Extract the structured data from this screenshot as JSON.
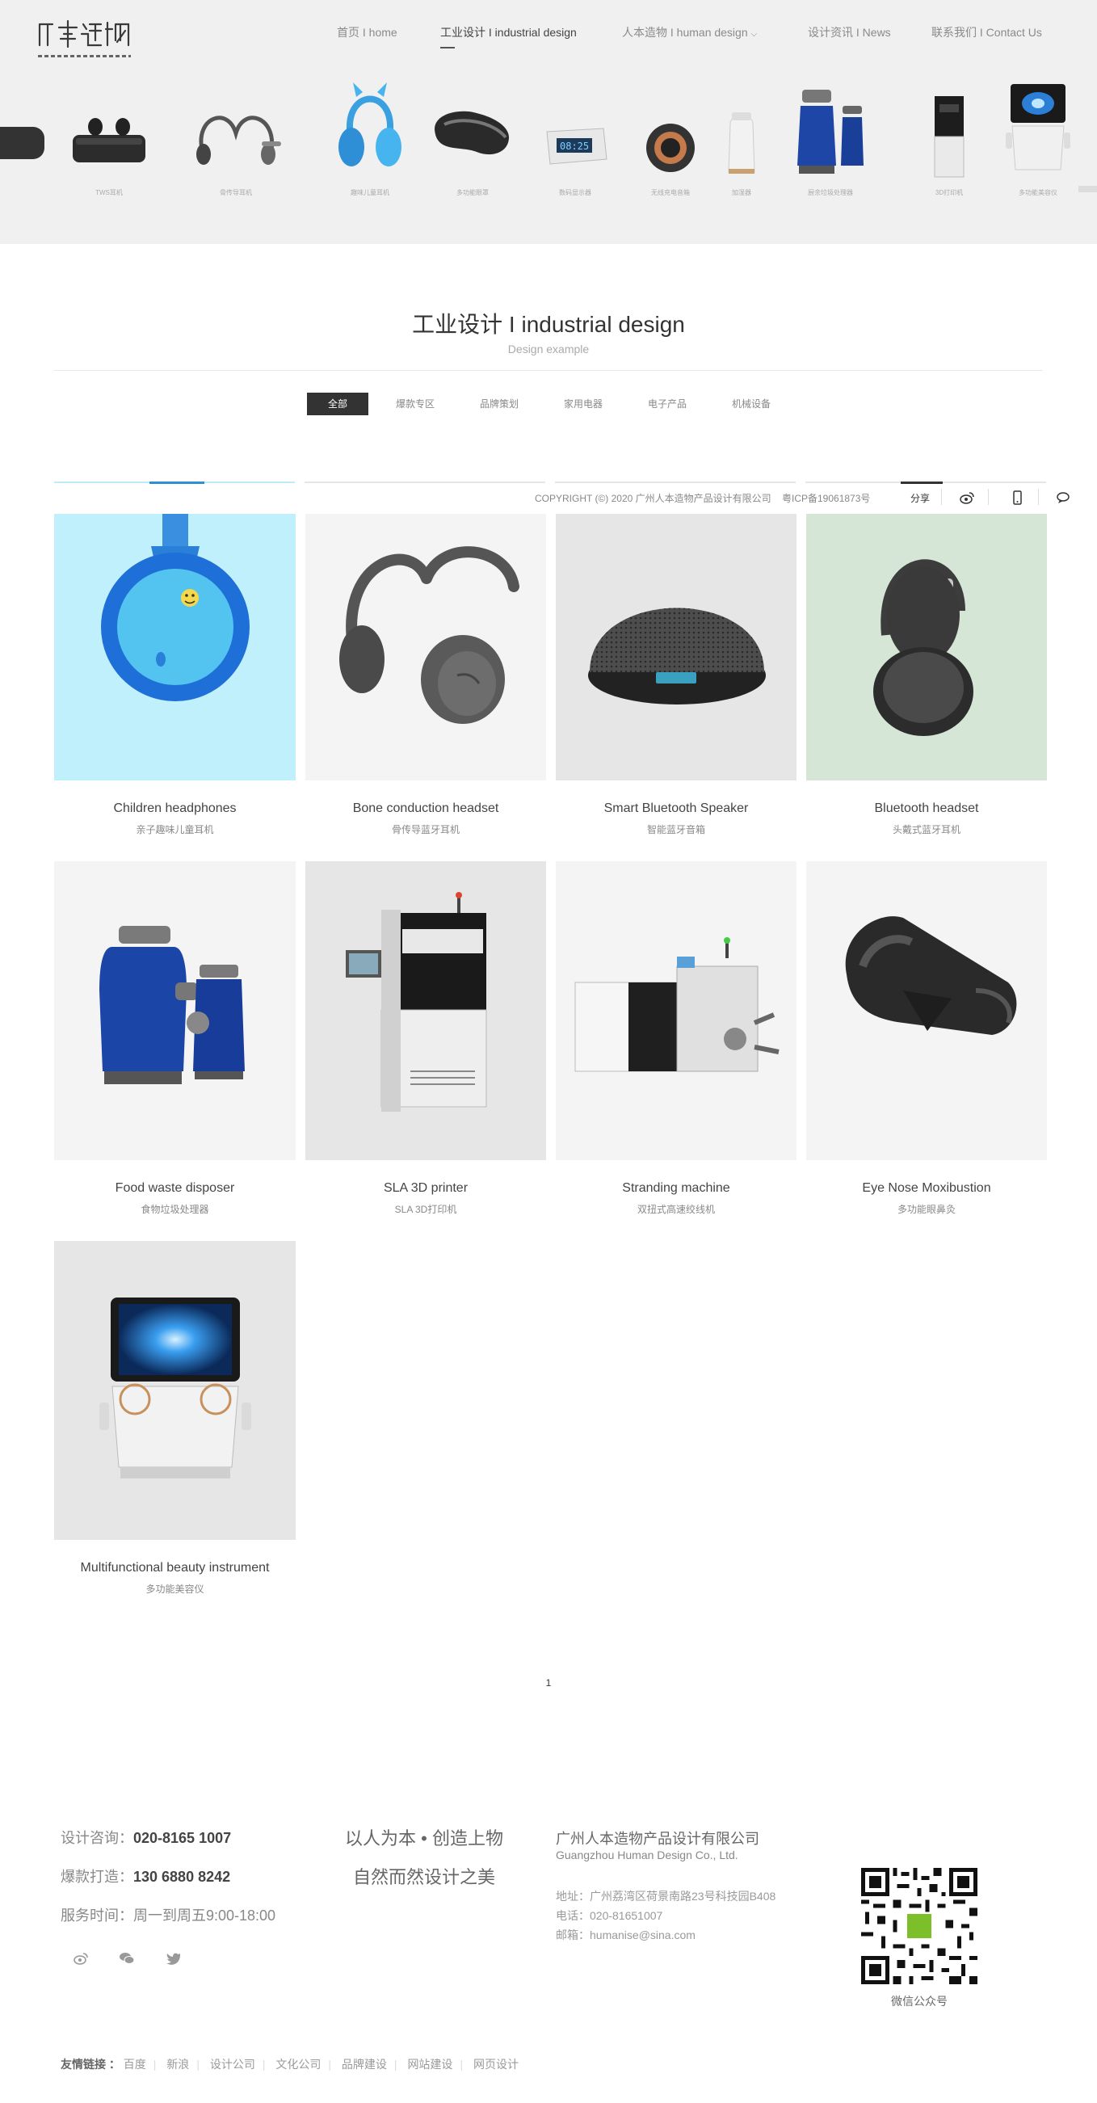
{
  "header": {
    "logo_alt": "人本造物",
    "nav": [
      {
        "label": "首页 I home"
      },
      {
        "label": "工业设计 I industrial design"
      },
      {
        "label": "人本造物 I human design"
      },
      {
        "label": "设计资讯 I News"
      },
      {
        "label": "联系我们 I Contact Us"
      }
    ],
    "strip_labels": [
      "",
      "TWS耳机",
      "骨传导耳机",
      "趣味儿童耳机",
      "多功能眼罩",
      "数码显示器",
      "无线充电音箱",
      "加湿器",
      "厨余垃圾处理器",
      "3D打印机",
      "多功能美容仪",
      ""
    ]
  },
  "section": {
    "title": "工业设计 I industrial design",
    "subtitle": "Design example",
    "filters": [
      "全部",
      "爆款专区",
      "品牌策划",
      "家用电器",
      "电子产品",
      "机械设备"
    ]
  },
  "copyright_bar": {
    "copyright": "COPYRIGHT (©) 2020 广州人本造物产品设计有限公司",
    "icp": "粤ICP备19061873号",
    "share": "分享"
  },
  "products": [
    {
      "title": "Children headphones",
      "subtitle": "亲子趣味儿童耳机"
    },
    {
      "title": "Bone conduction headset",
      "subtitle": "骨传导蓝牙耳机"
    },
    {
      "title": "Smart Bluetooth Speaker",
      "subtitle": "智能蓝牙音箱"
    },
    {
      "title": "Bluetooth headset",
      "subtitle": "头戴式蓝牙耳机"
    },
    {
      "title": "Food waste disposer",
      "subtitle": "食物垃圾处理器"
    },
    {
      "title": "SLA 3D printer",
      "subtitle": "SLA 3D打印机"
    },
    {
      "title": "Stranding machine",
      "subtitle": "双扭式高速绞线机"
    },
    {
      "title": "Eye Nose Moxibustion",
      "subtitle": "多功能眼鼻灸"
    },
    {
      "title": "Multifunctional beauty instrument",
      "subtitle": "多功能美容仪"
    }
  ],
  "pagination": {
    "current": "1"
  },
  "footer": {
    "consult_label": "设计咨询：",
    "consult_phone": "020-8165 1007",
    "hit_label": "爆款打造：",
    "hit_phone": "130 6880 8242",
    "hours": "服务时间：周一到周五9:00-18:00",
    "slogan_1": "以人为本 • 创造上物",
    "slogan_2": "自然而然设计之美",
    "company_cn": "广州人本造物产品设计有限公司",
    "company_en": "Guangzhou Human Design Co., Ltd.",
    "address": "地址：广州荔湾区荷景南路23号科技园B408",
    "phone": "电话：020-81651007",
    "email": "邮箱：humanise@sina.com",
    "qr_label": "微信公众号",
    "links_label": "友情链接 ：",
    "links": [
      "百度",
      "新浪",
      "设计公司",
      "文化公司",
      "品牌建设",
      "网站建设",
      "网页设计"
    ]
  },
  "icons": {
    "weibo": "weibo-icon",
    "wechat": "wechat-icon",
    "twitter": "twitter-icon",
    "mobile": "mobile-icon",
    "chat": "chat-icon"
  }
}
